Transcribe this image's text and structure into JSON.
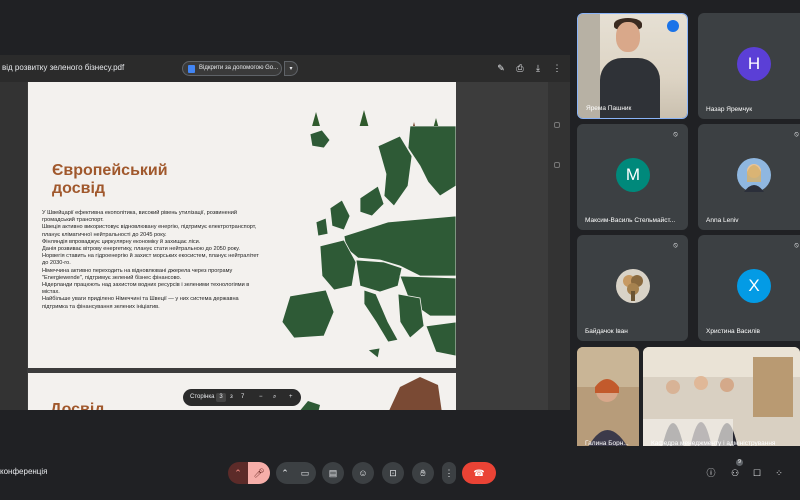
{
  "share": {
    "file_title": "від розвитку зеленого бізнесу.pdf",
    "open_with_label": "Відкрити за допомогою Go...",
    "slide": {
      "heading_line1": "Європейський",
      "heading_line2": "досвід",
      "paragraphs": [
        "У Швейцарії ефективна екополітика, високий рівень утилізації, розвинений громадський транспорт.",
        " Швеція активно використовує відновлювану енергію, підтримує електротранспорт, планує кліматичної нейтральності до 2045 року.",
        " Фінляндія впроваджує циркулярну економіку й захищає ліси.",
        " Данія розвиває вітрову енергетику, планує стати нейтральною до 2050 року.",
        " Норвегія ставить на гідроенергію й захист морських екосистем, планує нейтралітет до 2030-го.",
        " Німеччина активно переходить на відновлювані джерела через програму \"Energiewende\", підтримує зелений бізнес фінансово.",
        " Нідерланди працюють над захистом водних ресурсів і зеленими технологіями в містах.",
        " Найбільше уваги приділено Німеччині та Швеції — у них система державна підтримка та фінансування зелених ініціатив."
      ]
    },
    "next_slide_heading": "Досвід",
    "page_control": {
      "label": "Сторінка",
      "current": "3",
      "separator": "з",
      "total": "7",
      "minus": "−",
      "plus": "+"
    }
  },
  "participants": [
    {
      "name": "Ярема Пашник",
      "type": "video",
      "speaking": true
    },
    {
      "name": "Назар Яремчук",
      "type": "avatar",
      "letter": "Н",
      "color": "#5b3fd6"
    },
    {
      "name": "Максим-Василь Стельмайст...",
      "type": "avatar",
      "letter": "М",
      "color": "#00897b",
      "muted": true
    },
    {
      "name": "Anna Leniv",
      "type": "photo",
      "muted": true
    },
    {
      "name": "Байдачок Іван",
      "type": "photo",
      "muted": true
    },
    {
      "name": "Христина Василів",
      "type": "avatar",
      "letter": "Х",
      "color": "#039be5",
      "muted": true
    },
    {
      "name": "Галина Борн...",
      "type": "video"
    },
    {
      "name": "Кафедра менеджменту і адміністрування",
      "type": "video"
    }
  ],
  "bottom": {
    "meeting_title": "конференція",
    "participant_count": "9"
  },
  "colors": {
    "background": "#202124",
    "tile": "#3c4043",
    "accent_heading": "#a0582c",
    "map_green": "#2e5a36",
    "end_call": "#ea4335"
  }
}
